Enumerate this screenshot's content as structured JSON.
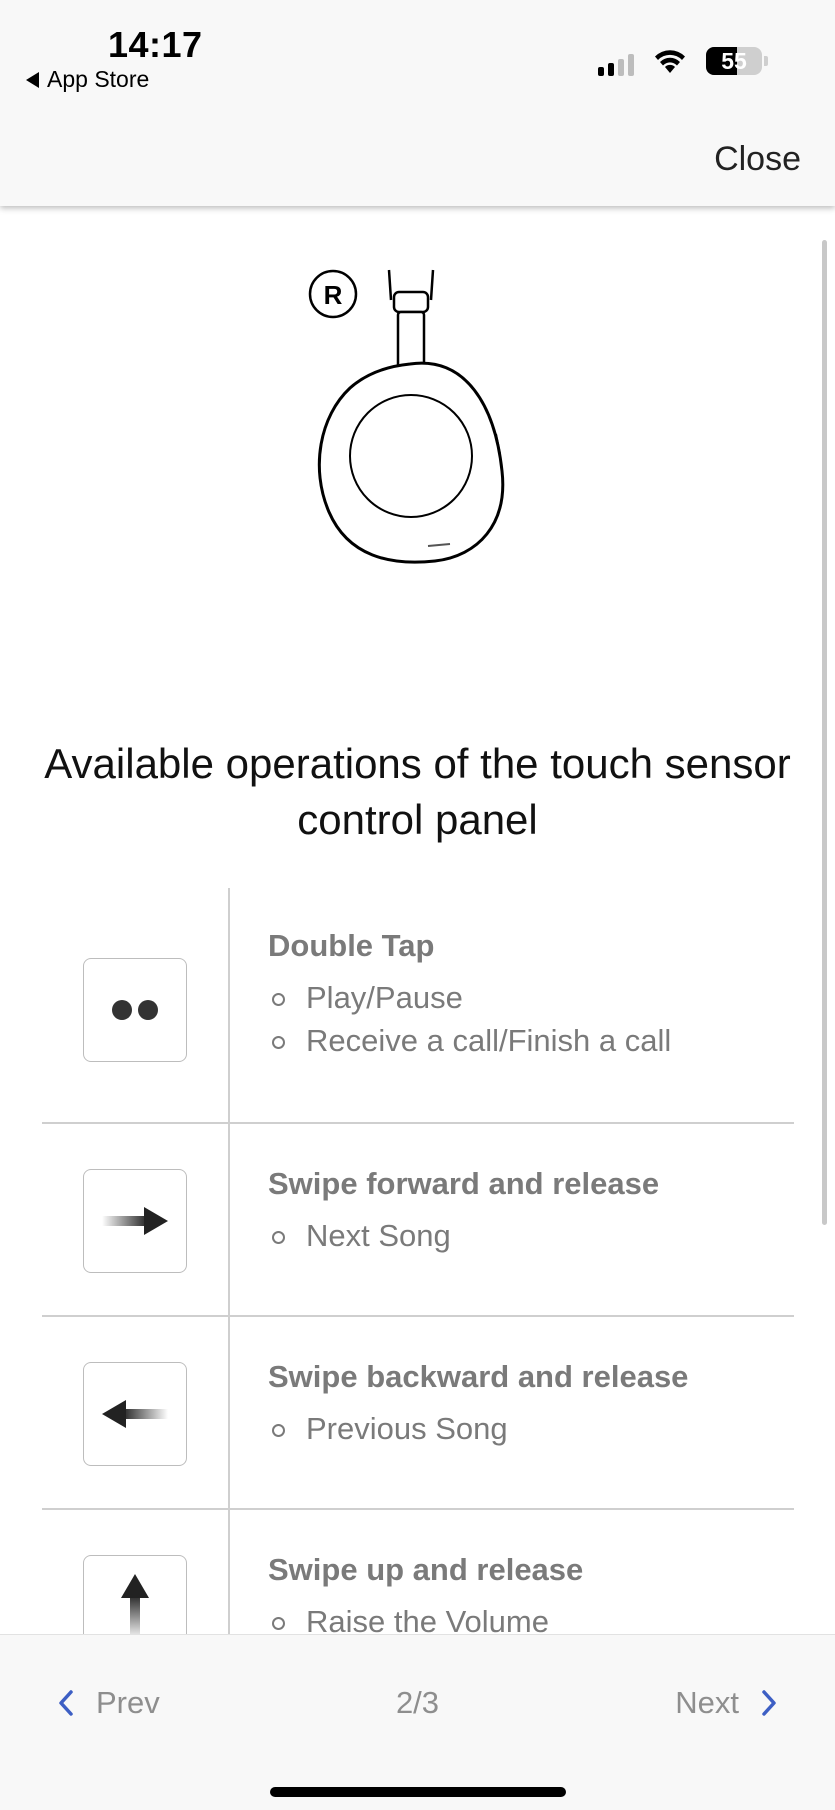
{
  "status_bar": {
    "time": "14:17",
    "back_app_label": "App Store",
    "battery_level": "55",
    "battery_fraction": 0.55,
    "signal_bars_active": 2,
    "signal_bars_total": 4
  },
  "header": {
    "close_label": "Close"
  },
  "illustration": {
    "side_label": "R",
    "icon": "headphone-earcup-icon"
  },
  "main": {
    "heading": "Available operations of the touch sensor control panel",
    "operations": [
      {
        "icon": "double-tap-icon",
        "title": "Double Tap",
        "actions": [
          "Play/Pause",
          "Receive a call/Finish a call"
        ]
      },
      {
        "icon": "swipe-forward-icon",
        "title": "Swipe forward and release",
        "actions": [
          "Next Song"
        ]
      },
      {
        "icon": "swipe-backward-icon",
        "title": "Swipe backward and release",
        "actions": [
          "Previous Song"
        ]
      },
      {
        "icon": "swipe-up-icon",
        "title": "Swipe up and release",
        "actions": [
          "Raise the Volume"
        ]
      }
    ]
  },
  "footer": {
    "prev_label": "Prev",
    "page_indicator": "2/3",
    "next_label": "Next",
    "accent_color": "#3d5fc4"
  }
}
